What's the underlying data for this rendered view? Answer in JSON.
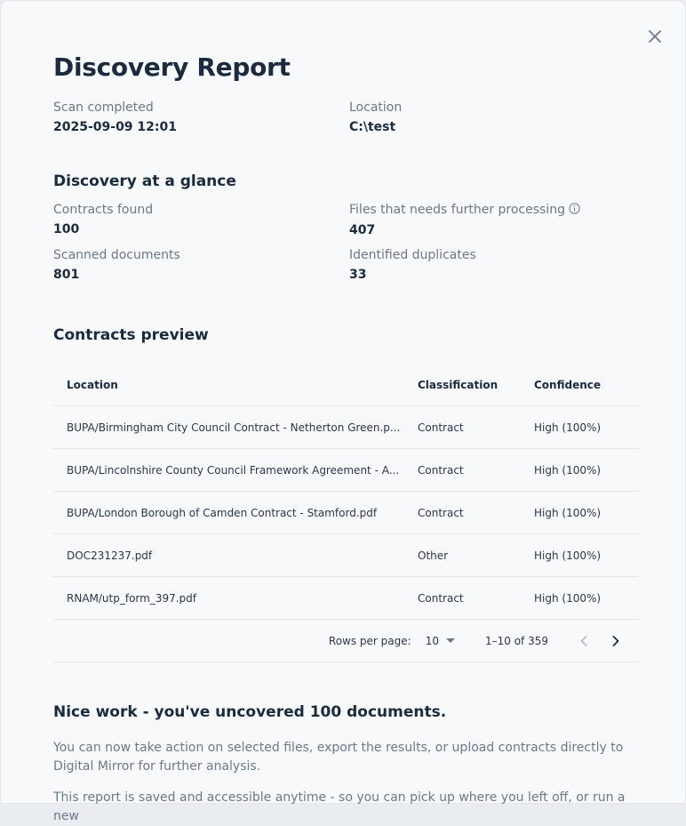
{
  "title": "Discovery Report",
  "scan": {
    "label": "Scan completed",
    "value": "2025-09-09 12:01"
  },
  "location": {
    "label": "Location",
    "value": "C:\\test"
  },
  "glance": {
    "title": "Discovery at a glance",
    "contracts_found": {
      "label": "Contracts found",
      "value": "100"
    },
    "further_processing": {
      "label": "Files that needs further processing",
      "value": "407"
    },
    "scanned_documents": {
      "label": "Scanned documents",
      "value": "801"
    },
    "duplicates": {
      "label": "Identified duplicates",
      "value": "33"
    }
  },
  "preview": {
    "title": "Contracts preview",
    "columns": [
      "Location",
      "Classification",
      "Confidence"
    ],
    "rows": [
      [
        "BUPA/Birmingham City Council Contract - Netherton Green.p...",
        "Contract",
        "High (100%)"
      ],
      [
        "BUPA/Lincolnshire County Council Framework Agreement - A...",
        "Contract",
        "High (100%)"
      ],
      [
        "BUPA/London Borough of Camden Contract - Stamford.pdf",
        "Contract",
        "High (100%)"
      ],
      [
        "DOC231237.pdf",
        "Other",
        "High (100%)"
      ],
      [
        "RNAM/utp_form_397.pdf",
        "Contract",
        "High (100%)"
      ]
    ],
    "pagination": {
      "rows_per_page_label": "Rows per page:",
      "rows_per_page_value": "10",
      "range": "1–10 of 359"
    }
  },
  "summary": {
    "title": "Nice work - you've uncovered 100 documents.",
    "paragraph1": "You can now take action on selected files, export the results, or upload contracts directly to Digital Mirror for further analysis.",
    "paragraph2": "This report is saved and accessible anytime - so you can pick up where you left off, or run a new"
  },
  "icons": {
    "close": "close-icon",
    "info": "info-icon",
    "dropdown": "chevron-down-icon",
    "prev": "chevron-left-icon",
    "next": "chevron-right-icon"
  },
  "colors": {
    "heading": "#1b2a3d",
    "muted": "#6c7886",
    "background": "#f8f9fb",
    "divider": "#e2e5e9"
  }
}
